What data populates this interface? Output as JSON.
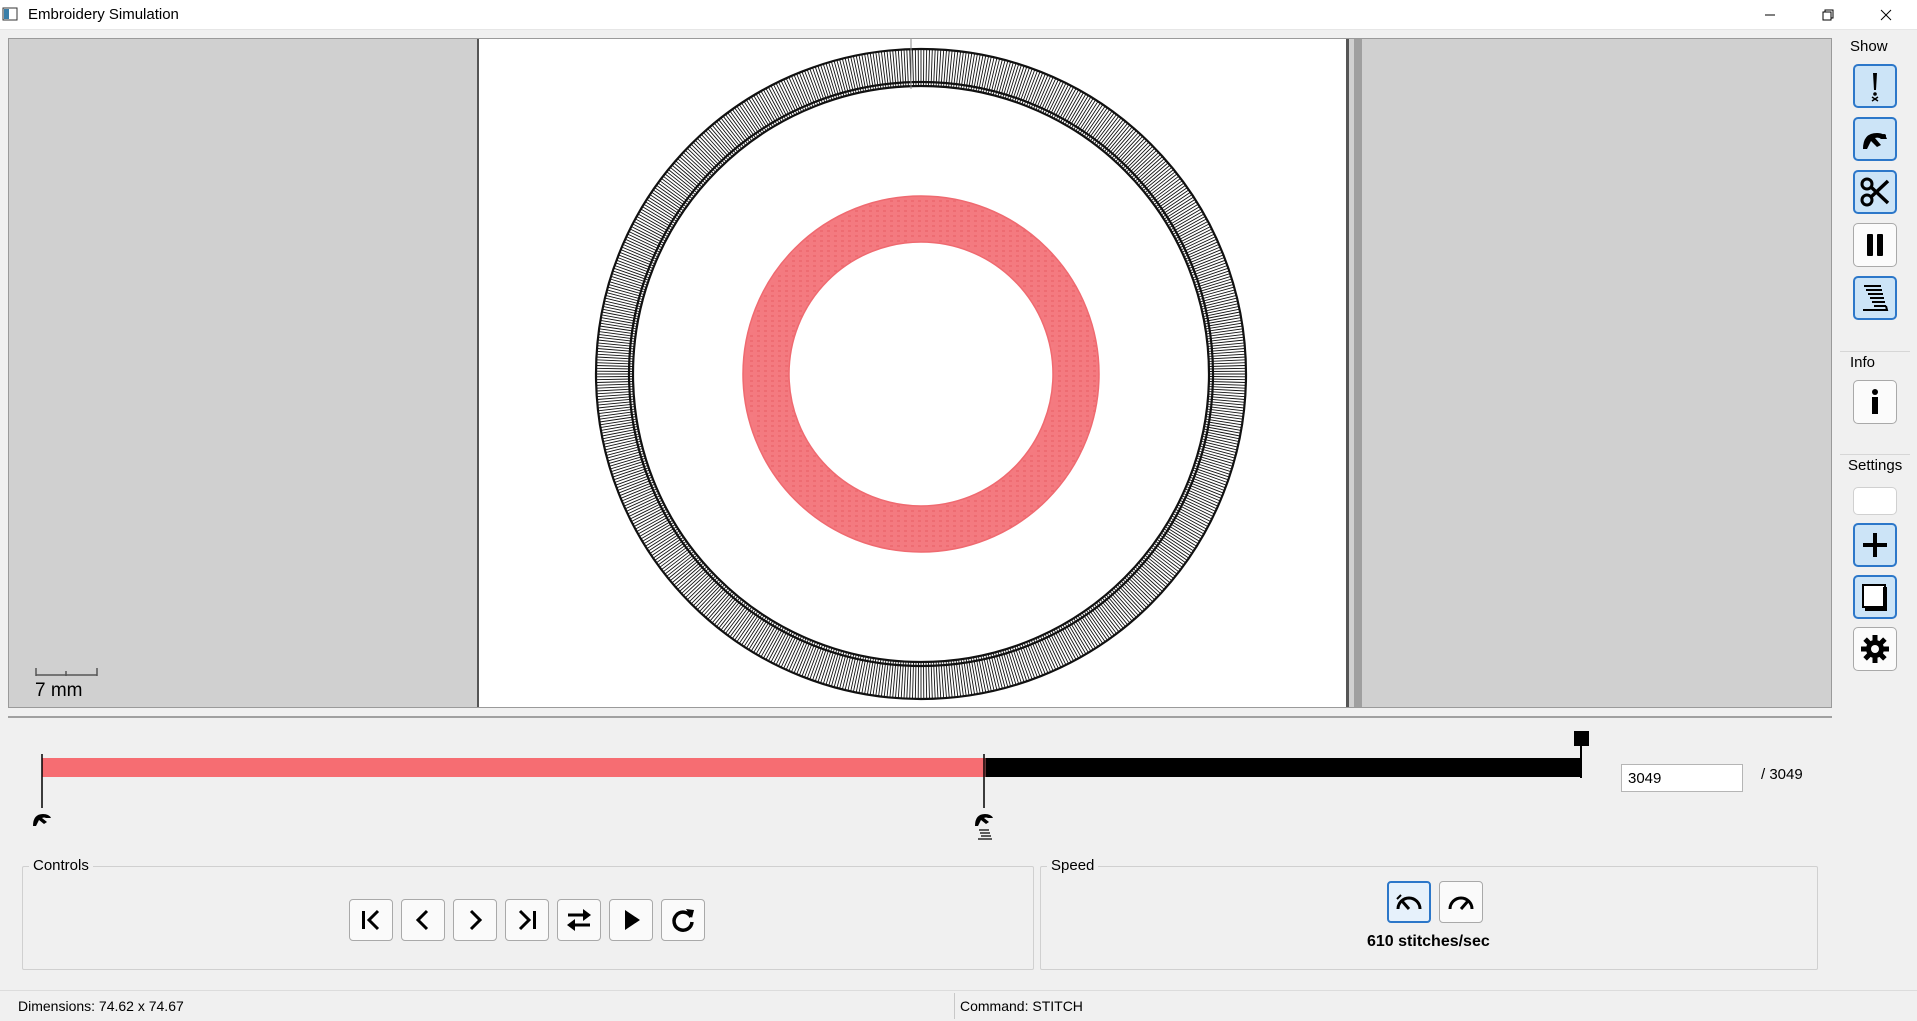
{
  "window": {
    "title": "Embroidery Simulation"
  },
  "canvas": {
    "scale_label": "7 mm",
    "design_colors": {
      "outer_ring": "#111111",
      "inner_ring": "#f47a80"
    }
  },
  "sidebar": {
    "show_label": "Show",
    "show_buttons": [
      {
        "icon": "jump-stitch-icon"
      },
      {
        "icon": "needle-foot-icon"
      },
      {
        "icon": "scissors-icon"
      },
      {
        "icon": "pause-icon"
      },
      {
        "icon": "thread-lines-icon"
      }
    ],
    "info_label": "Info",
    "info_button": {
      "icon": "info-icon"
    },
    "settings_label": "Settings",
    "settings_buttons": [
      {
        "icon": "blank-icon"
      },
      {
        "icon": "crosshair-plus-icon"
      },
      {
        "icon": "page-icon"
      },
      {
        "icon": "gear-icon"
      }
    ]
  },
  "timeline": {
    "current_stitch": "3049",
    "total_label": "/ 3049",
    "color_segments": [
      {
        "color": "#f66d72",
        "fraction": 0.613
      },
      {
        "color": "#000000",
        "fraction": 0.387
      }
    ]
  },
  "controls": {
    "label": "Controls",
    "buttons": [
      {
        "icon": "first-icon"
      },
      {
        "icon": "prev-icon"
      },
      {
        "icon": "next-icon"
      },
      {
        "icon": "last-icon"
      },
      {
        "icon": "swap-direction-icon"
      },
      {
        "icon": "play-icon"
      },
      {
        "icon": "restart-icon"
      }
    ]
  },
  "speed": {
    "label": "Speed",
    "value_text": "610 stitches/sec"
  },
  "status": {
    "dimensions": "Dimensions: 74.62 x 74.67",
    "command": "Command: STITCH"
  }
}
